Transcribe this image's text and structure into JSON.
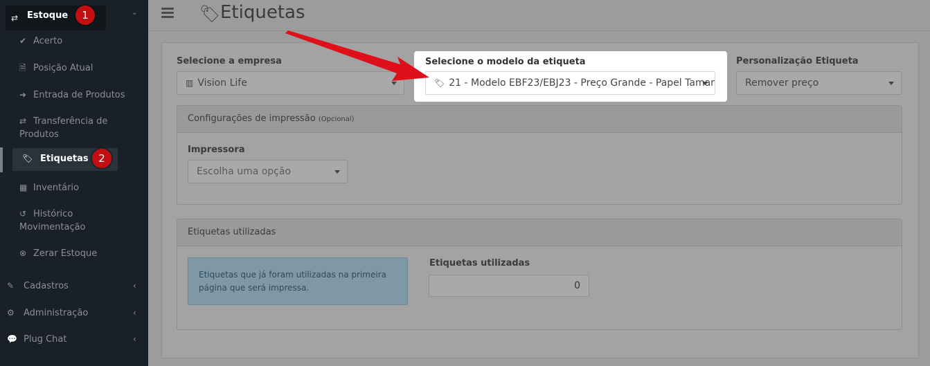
{
  "sidebar": {
    "parent": {
      "label": "Estoque",
      "icon": "exchange-icon",
      "badge": "1"
    },
    "items": [
      {
        "label": "Acerto",
        "icon": "check-icon"
      },
      {
        "label": "Posição Atual",
        "icon": "document-icon"
      },
      {
        "label": "Entrada de Produtos",
        "icon": "sign-in-icon"
      },
      {
        "label_line1": "Transferência de",
        "label_line2": "Produtos",
        "icon": "exchange-icon"
      },
      {
        "label": "Etiquetas",
        "icon": "tag-icon",
        "badge": "2",
        "active": true
      },
      {
        "label": "Inventário",
        "icon": "calculator-icon"
      },
      {
        "label_line1": "Histórico",
        "label_line2": "Movimentação",
        "icon": "history-icon"
      },
      {
        "label": "Zerar Estoque",
        "icon": "times-circle-icon"
      }
    ],
    "sections": [
      {
        "label": "Cadastros",
        "icon": "edit-icon"
      },
      {
        "label": "Administração",
        "icon": "cogs-icon"
      },
      {
        "label": "Plug Chat",
        "icon": "chat-icon"
      }
    ]
  },
  "header": {
    "title": "Etiquetas",
    "title_icon": "tag-icon"
  },
  "form": {
    "empresa": {
      "label": "Selecione a empresa",
      "value": "Vision Life"
    },
    "modelo": {
      "label": "Selecione o modelo da etiqueta",
      "value": "21 - Modelo EBF23/EBJ23 - Preço Grande - Papel Taman"
    },
    "personalizacao": {
      "label": "Personalização Etiqueta",
      "value": "Remover preço"
    }
  },
  "config": {
    "title": "Configurações de impressão",
    "title_small": "(Opcional)",
    "impressora_label": "Impressora",
    "impressora_placeholder": "Escolha uma opção"
  },
  "used": {
    "title": "Etiquetas utilizadas",
    "info": "Etiquetas que já foram utilizadas na primeira página que será impressa.",
    "field_label": "Etiquetas utilizadas",
    "value": "0"
  },
  "colors": {
    "sidebar_bg": "#1a2027",
    "badge": "#c30f12",
    "arrow": "#e0101a",
    "info_bg": "#7f98a6"
  }
}
